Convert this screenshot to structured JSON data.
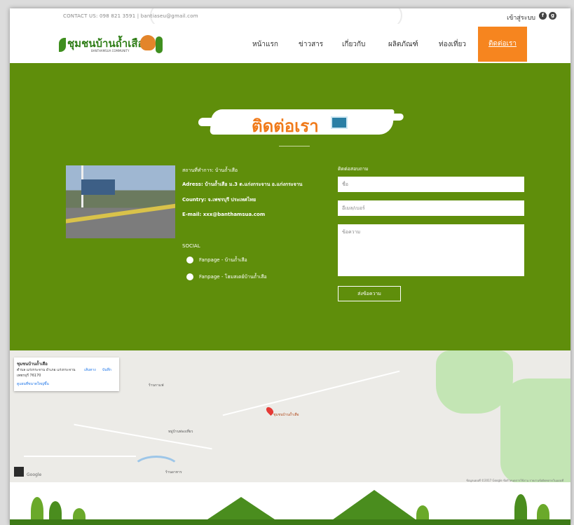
{
  "header": {
    "contact": "CONTACT US: 098 821 3591 | bantiaseu@gmail.com",
    "login": "เข้าสู่ระบบ",
    "social_icons": [
      "facebook-icon",
      "google-plus-icon"
    ],
    "logo_text": "ชุมชนบ้านถ้ำเสือ",
    "logo_sub": "BANTHAMSUA COMMUNITY"
  },
  "nav": {
    "items": [
      "หน้าแรก",
      "ข่าวสาร",
      "เกี่ยวกับ",
      "ผลิตภัณฑ์",
      "ท่องเที่ยว",
      "ติดต่อเรา"
    ],
    "active_index": 5
  },
  "colors": {
    "green_bg": "#5f8e0b",
    "accent_orange": "#f6851f",
    "title_orange": "#f07a1a"
  },
  "contact_section": {
    "title": "ติดต่อเรา",
    "location": "สถานที่ทำการ: บ้านถ้ำเสือ",
    "address": "Adress: บ้านถ้ำเสือ ม.3 ต.แก่งกระจาน อ.แก่งกระจาน",
    "country": "Country: จ.เพชรบุรี ประเทศไทย",
    "email": "E-mail: xxx@banthamsua.com",
    "social_title": "SOCIAL",
    "social_links": [
      "Fanpage - บ้านถ้ำเสือ",
      "Fanpage - โฮมสเตย์บ้านถ้ำเสือ"
    ]
  },
  "form": {
    "title": "ติดต่อสอบถาม",
    "name_placeholder": "ชื่อ",
    "email_placeholder": "อีเมล/เบอร์",
    "message_placeholder": "ข้อความ",
    "send_label": "ส่งข้อความ"
  },
  "map": {
    "card_title": "ชุมชนบ้านถ้ำเสือ",
    "card_address": "ตำบล แก่งกระจาน อำเภอ แก่งกระจาน เพชรบุรี 76170",
    "card_link": "ดูแผนที่ขนาดใหญ่ขึ้น",
    "card_actions": [
      "เส้นทาง",
      "บันทึก"
    ],
    "pin_label": "ชุมชนบ้านถ้ำเสือ",
    "labels": [
      "ร้านกาแฟ",
      "หมู่บ้านท่องเที่ยว",
      "ร้านอาหาร"
    ],
    "google": "Google",
    "footer": "ข้อมูลแผนที่ ©2017 Google  ข้อกำหนดการใช้งาน  รายงานข้อผิดพลาดในแผนที่"
  }
}
